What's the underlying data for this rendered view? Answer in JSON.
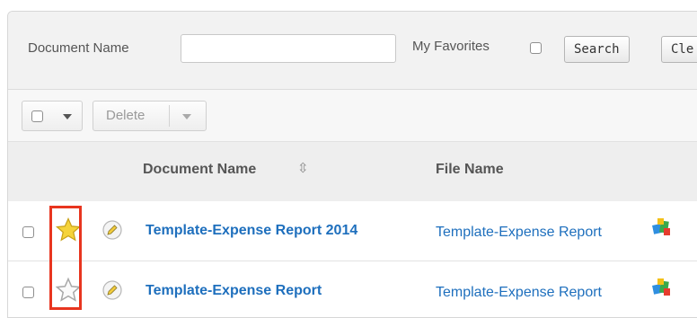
{
  "search": {
    "doc_name_label": "Document Name",
    "doc_name_value": "",
    "favorites_label": "My Favorites",
    "favorites_checked": false,
    "search_button": "Search",
    "clear_button": "Cle"
  },
  "actions": {
    "delete_label": "Delete"
  },
  "table": {
    "columns": [
      "Document Name",
      "File Name"
    ],
    "rows": [
      {
        "favorite": true,
        "document_name": "Template-Expense Report 2014",
        "file_name": "Template-Expense Report"
      },
      {
        "favorite": false,
        "document_name": "Template-Expense Report",
        "file_name": "Template-Expense Report"
      }
    ]
  },
  "colors": {
    "link": "#1e6fbd",
    "star_active": "#f5d33a",
    "highlight": "#e8351f"
  },
  "icons": [
    "chevron-down-icon",
    "sort-icon",
    "star-icon",
    "star-outline-icon",
    "pencil-icon",
    "google-docs-icon"
  ]
}
